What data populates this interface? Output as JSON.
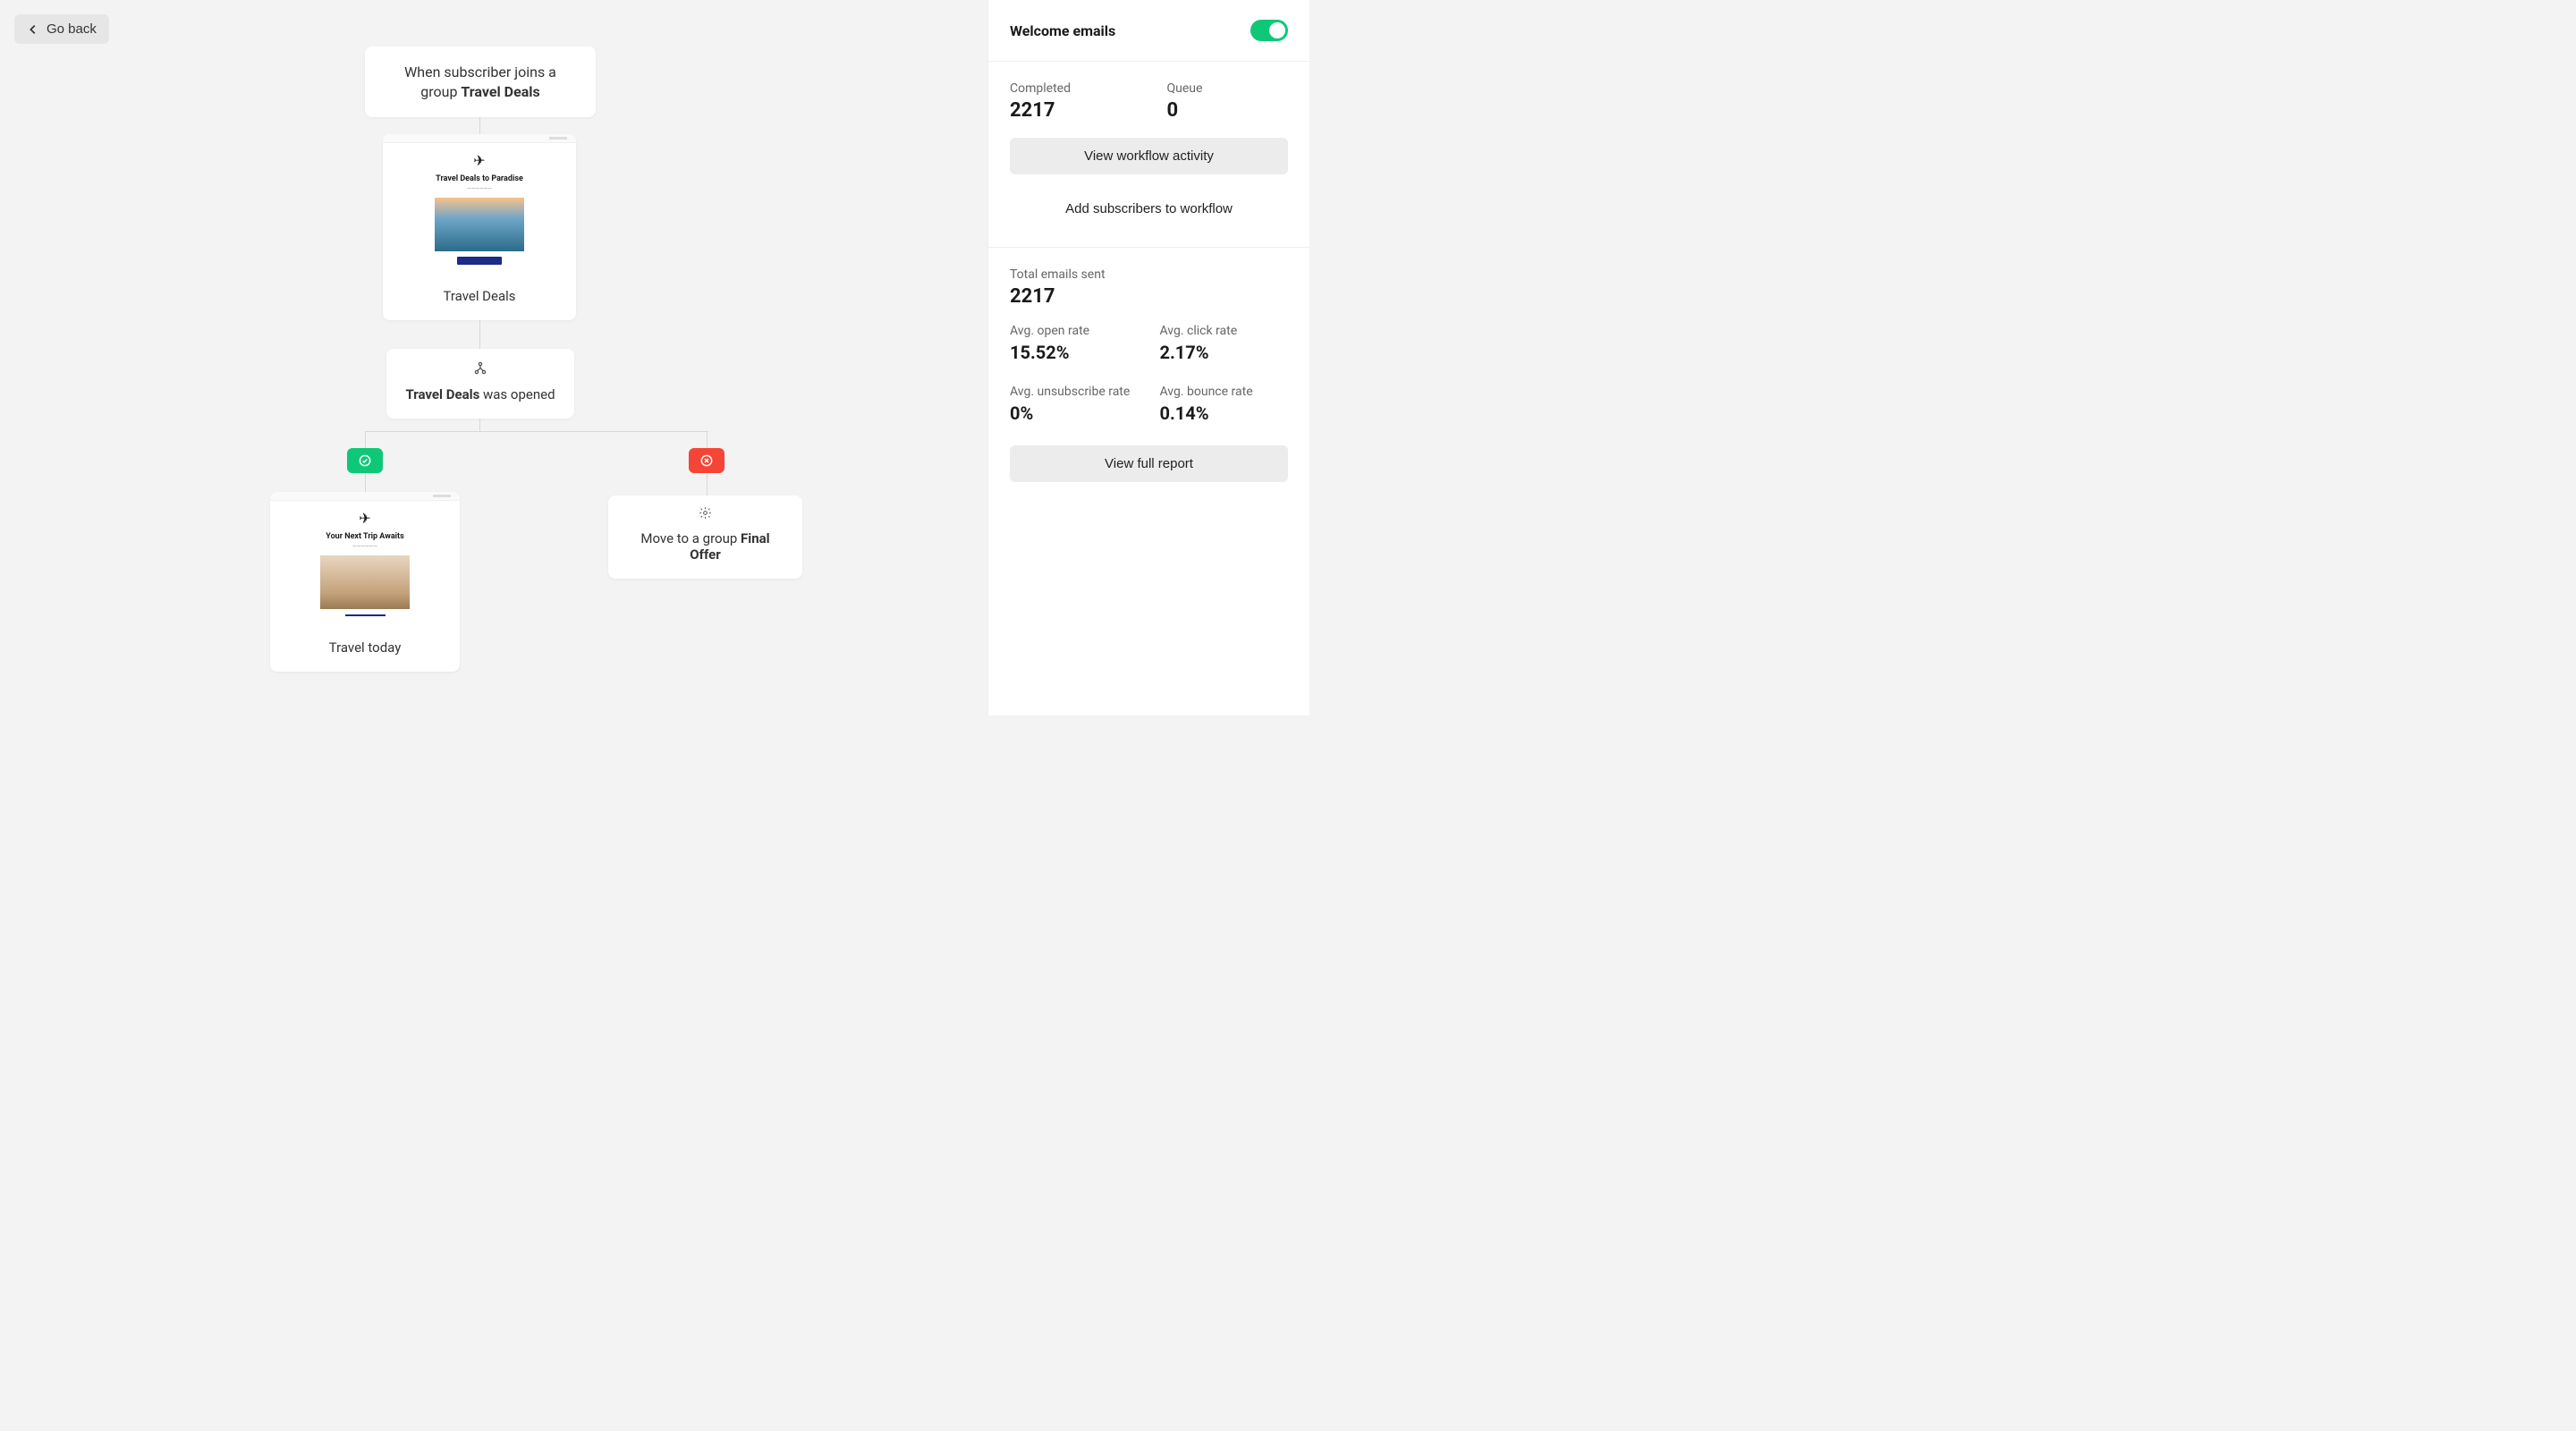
{
  "nav": {
    "go_back": "Go back"
  },
  "workflow": {
    "trigger": {
      "prefix": "When subscriber joins a group ",
      "group": "Travel Deals"
    },
    "email1": {
      "preview_title": "Travel Deals to Paradise",
      "name": "Travel Deals"
    },
    "condition": {
      "subject": "Travel Deals",
      "suffix": " was opened"
    },
    "email2": {
      "preview_title": "Your Next Trip Awaits",
      "name": "Travel today"
    },
    "action": {
      "prefix": "Move to a group ",
      "group": "Final Offer"
    }
  },
  "sidebar": {
    "title": "Welcome emails",
    "completed_label": "Completed",
    "completed_value": "2217",
    "queue_label": "Queue",
    "queue_value": "0",
    "view_activity": "View workflow activity",
    "add_subscribers": "Add subscribers to workflow",
    "total_label": "Total emails sent",
    "total_value": "2217",
    "open_label": "Avg. open rate",
    "open_value": "15.52%",
    "click_label": "Avg. click rate",
    "click_value": "2.17%",
    "unsub_label": "Avg. unsubscribe rate",
    "unsub_value": "0%",
    "bounce_label": "Avg. bounce rate",
    "bounce_value": "0.14%",
    "full_report": "View full report"
  }
}
